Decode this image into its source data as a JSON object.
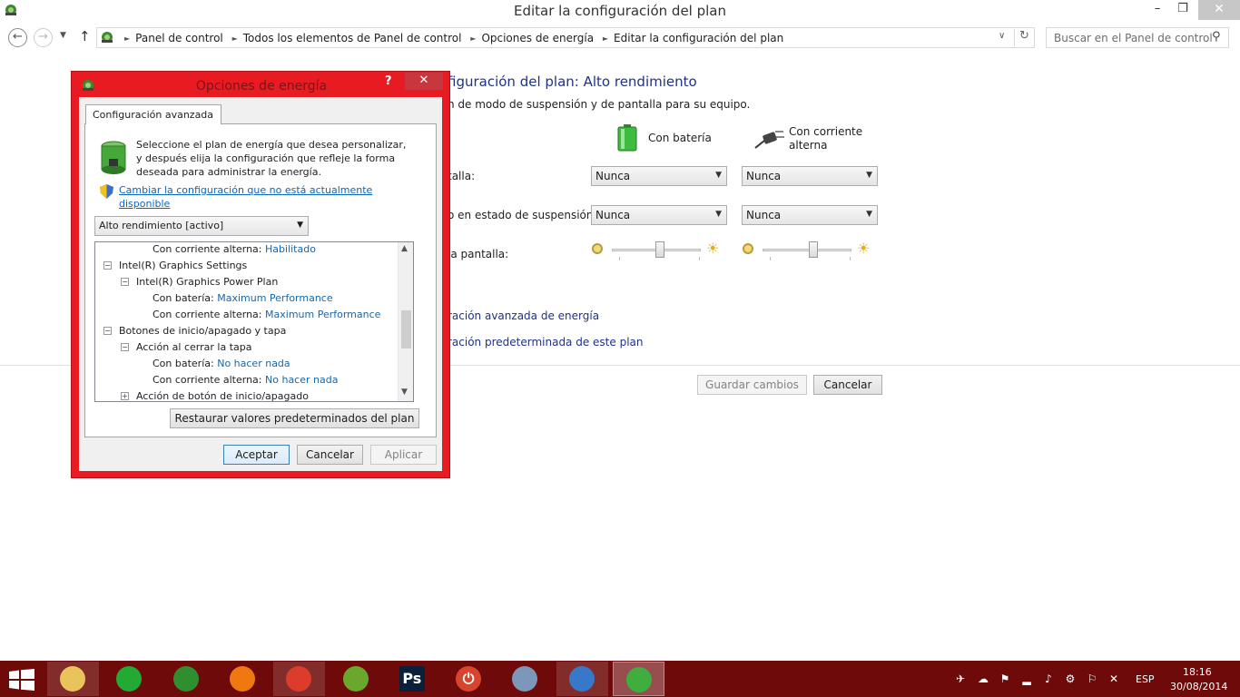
{
  "window": {
    "title": "Editar la configuración del plan",
    "minimize_glyph": "–",
    "maximize_glyph": "❐",
    "close_glyph": "✕"
  },
  "navbar": {
    "back_glyph": "←",
    "forward_glyph": "→",
    "recent_glyph": "▼",
    "up_glyph": "↑",
    "breadcrumbs": [
      "Panel de control",
      "Todos los elementos de Panel de control",
      "Opciones de energía",
      "Editar la configuración del plan"
    ],
    "breadcrumb_sep": "►",
    "dropdown_glyph": "∨",
    "refresh_glyph": "↻",
    "search_placeholder": "Buscar en el Panel de control",
    "search_icon": "search-icon"
  },
  "page": {
    "heading": "figuración del plan: Alto rendimiento",
    "subheading": "n de modo de suspensión y de pantalla para su equipo.",
    "col_battery": "Con batería",
    "col_ac": "Con corriente alterna",
    "rows": {
      "screen_label": "talla:",
      "sleep_label": "o en estado de suspensión:",
      "brightness_label": "la pantalla:"
    },
    "screen_battery": "Nunca",
    "screen_ac": "Nunca",
    "sleep_battery": "Nunca",
    "sleep_ac": "Nunca",
    "brightness_battery_level": 0.55,
    "brightness_ac_level": 0.58,
    "link_advanced": "ración avanzada de energía",
    "link_restore": "ración predeterminada de este plan",
    "save_button": "Guardar cambios",
    "cancel_button": "Cancelar"
  },
  "dialog": {
    "title": "Opciones de energía",
    "help_glyph": "?",
    "close_glyph": "✕",
    "tab_label": "Configuración avanzada",
    "description": "Seleccione el plan de energía que desea personalizar, y después elija la configuración que refleje la forma deseada para administrar la energía.",
    "change_link": "Cambiar la configuración que no está actualmente disponible",
    "plan_selected": "Alto rendimiento [activo]",
    "tree": [
      {
        "label": "Con corriente alterna:",
        "value": "Habilitado",
        "expander": ""
      },
      {
        "label": "Intel(R) Graphics Settings",
        "value": "",
        "expander": "−"
      },
      {
        "label": "Intel(R) Graphics Power Plan",
        "value": "",
        "expander": "−"
      },
      {
        "label": "Con batería:",
        "value": "Maximum Performance",
        "expander": ""
      },
      {
        "label": "Con corriente alterna:",
        "value": "Maximum Performance",
        "expander": ""
      },
      {
        "label": "Botones de inicio/apagado y tapa",
        "value": "",
        "expander": "−"
      },
      {
        "label": "Acción al cerrar la tapa",
        "value": "",
        "expander": "−"
      },
      {
        "label": "Con batería:",
        "value": "No hacer nada",
        "expander": ""
      },
      {
        "label": "Con corriente alterna:",
        "value": "No hacer nada",
        "expander": ""
      },
      {
        "label": "Acción de botón de inicio/apagado",
        "value": "",
        "expander": "+"
      }
    ],
    "restore_button": "Restaurar valores predeterminados del plan",
    "ok_button": "Aceptar",
    "cancel_button": "Cancelar",
    "apply_button": "Aplicar"
  },
  "taskbar": {
    "apps": [
      {
        "name": "file-explorer-icon",
        "glyph": "",
        "state": "running"
      },
      {
        "name": "razer-app-icon",
        "glyph": "",
        "state": ""
      },
      {
        "name": "xbox-app-icon",
        "glyph": "",
        "state": ""
      },
      {
        "name": "media-player-icon",
        "glyph": "",
        "state": ""
      },
      {
        "name": "chrome-icon",
        "glyph": "",
        "state": "running"
      },
      {
        "name": "pen-app-icon",
        "glyph": "",
        "state": ""
      },
      {
        "name": "photoshop-icon",
        "glyph": "Ps",
        "state": ""
      },
      {
        "name": "power-app-icon",
        "glyph": "⏻",
        "state": ""
      },
      {
        "name": "paint-icon",
        "glyph": "",
        "state": ""
      },
      {
        "name": "control-panel-icon",
        "glyph": "",
        "state": "running"
      },
      {
        "name": "power-options-icon",
        "glyph": "",
        "state": "active"
      }
    ],
    "tray_glyphs": [
      "✈",
      "☁",
      "⚑",
      "▂",
      "♪",
      "⚙",
      "⚐",
      "✕"
    ],
    "language": "ESP",
    "time": "18:16",
    "date": "30/08/2014",
    "colors": {
      "taskbar": "#6e0a0a",
      "dialog_frame": "#e81b23"
    }
  }
}
